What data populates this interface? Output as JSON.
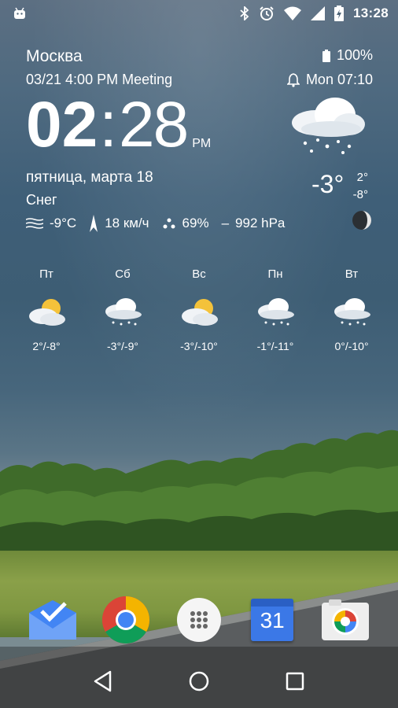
{
  "status_bar": {
    "time": "13:28",
    "icons": [
      "android-icon",
      "bluetooth-icon",
      "alarm-icon",
      "wifi-icon",
      "signal-icon",
      "battery-charging-icon"
    ]
  },
  "widget": {
    "city": "Москва",
    "event": "03/21 4:00 PM Meeting",
    "battery": "100%",
    "alarm": "Mon 07:10",
    "clock": {
      "hours": "02",
      "separator": ":",
      "minutes": "28",
      "ampm": "PM"
    },
    "date": "пятница, марта 18",
    "condition": "Снег",
    "feels_like": "-9°C",
    "wind": "18 км/ч",
    "humidity": "69%",
    "pressure_sep": "–",
    "pressure": "992 hPa",
    "current_temp": "-3°",
    "high": "2°",
    "low": "-8°"
  },
  "forecast": [
    {
      "day": "Пт",
      "range": "2°/-8°",
      "icon": "partly-sunny-icon"
    },
    {
      "day": "Сб",
      "range": "-3°/-9°",
      "icon": "snow-cloud-icon"
    },
    {
      "day": "Вс",
      "range": "-3°/-10°",
      "icon": "partly-sunny-icon"
    },
    {
      "day": "Пн",
      "range": "-1°/-11°",
      "icon": "snow-cloud-icon"
    },
    {
      "day": "Вт",
      "range": "0°/-10°",
      "icon": "snow-cloud-icon"
    }
  ],
  "dock": {
    "apps": [
      "inbox-app-icon",
      "chrome-app-icon",
      "app-drawer-icon",
      "calendar-app-icon",
      "photos-app-icon"
    ],
    "calendar_day": "31"
  },
  "colors": {
    "calendar_blue": "#3b78e7",
    "inbox_blue": "#4285f4"
  }
}
